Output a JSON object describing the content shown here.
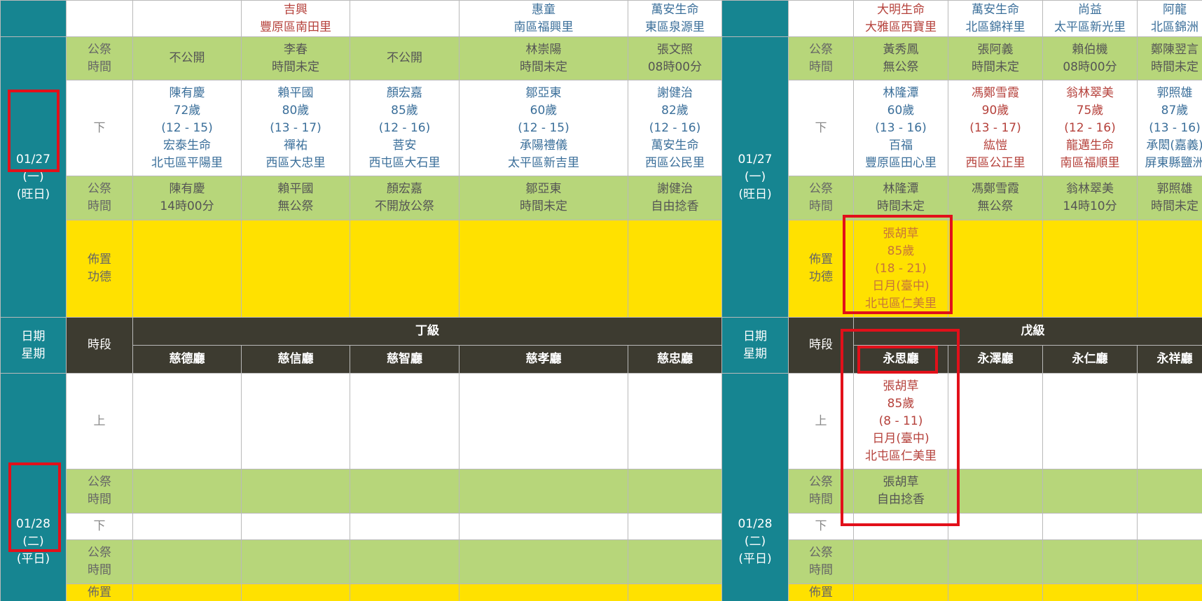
{
  "labels": {
    "gongji": "公祭時間",
    "xia": "下",
    "shang": "上",
    "buzhi": "佈置功德",
    "date_weekday": "日期星期",
    "shiduan": "時段"
  },
  "left": {
    "top_row": [
      "",
      "吉興|豐原區南田里",
      "",
      "惠童|南區福興里",
      "萬安生命|東區泉源里"
    ],
    "gong1": [
      "不公開",
      "李春|時間未定",
      "不公開",
      "林崇陽|時間未定",
      "張文照|08時00分"
    ],
    "date1": "01/27|(一)|(旺日)",
    "xia1": [
      "陳有慶|72歲|(12 - 15)|宏泰生命|北屯區平陽里",
      "賴平國|80歲|(13 - 17)|禪祐|西區大忠里",
      "顏宏嘉|85歲|(12 - 16)|菩安|西屯區大石里",
      "鄒亞東|60歲|(12 - 15)|承陽禮儀|太平區新吉里",
      "謝健治|82歲|(12 - 16)|萬安生命|西區公民里"
    ],
    "gong2": [
      "陳有慶|14時00分",
      "賴平國|無公祭",
      "顏宏嘉|不開放公祭",
      "鄒亞東|時間未定",
      "謝健治|自由捻香"
    ],
    "grade": "丁級",
    "halls": [
      "慈德廳",
      "慈信廳",
      "慈智廳",
      "慈孝廳",
      "慈忠廳"
    ],
    "date2": "01/28|(二)|(平日)"
  },
  "right": {
    "top_row": [
      "大明生命|大雅區西寶里",
      "萬安生命|北區錦祥里",
      "尚益|太平區新光里",
      "阿龍|北區錦洲"
    ],
    "gong1": [
      "黃秀鳳|無公祭",
      "張阿義|時間未定",
      "賴伯機|08時00分",
      "鄭陳翌言|時間未定"
    ],
    "date1": "01/27|(一)|(旺日)",
    "xia1": [
      "林隆潭|60歲|(13 - 16)|百福|豐原區田心里",
      "馮鄭雪霞|90歲|(13 - 17)|紘愷|西區公正里",
      "翁林翠美|75歲|(12 - 16)|龍邁生命|南區福順里",
      "郭照雄|87歲|(13 - 16)|承閎(嘉義)|屏東縣鹽洲"
    ],
    "gong2": [
      "林隆潭|時間未定",
      "馮鄭雪霞|無公祭",
      "翁林翠美|14時10分",
      "郭照雄|時間未定"
    ],
    "buzhi1": [
      "張胡草|85歲|(18 - 21)|日月(臺中)|北屯區仁美里",
      "",
      "",
      ""
    ],
    "grade": "戊級",
    "halls": [
      "永思廳",
      "永澤廳",
      "永仁廳",
      "永祥廳"
    ],
    "shang2": [
      "張胡草|85歲|(8 - 11)|日月(臺中)|北屯區仁美里",
      "",
      "",
      ""
    ],
    "gong3": [
      "張胡草|自由捻香",
      "",
      "",
      ""
    ],
    "date2": "01/28|(二)|(平日)"
  },
  "colors": {
    "teal": "#168591",
    "green": "#b7d67a",
    "yellow": "#ffe100",
    "dark": "#3d3b30",
    "highlight": "#e2101a"
  }
}
